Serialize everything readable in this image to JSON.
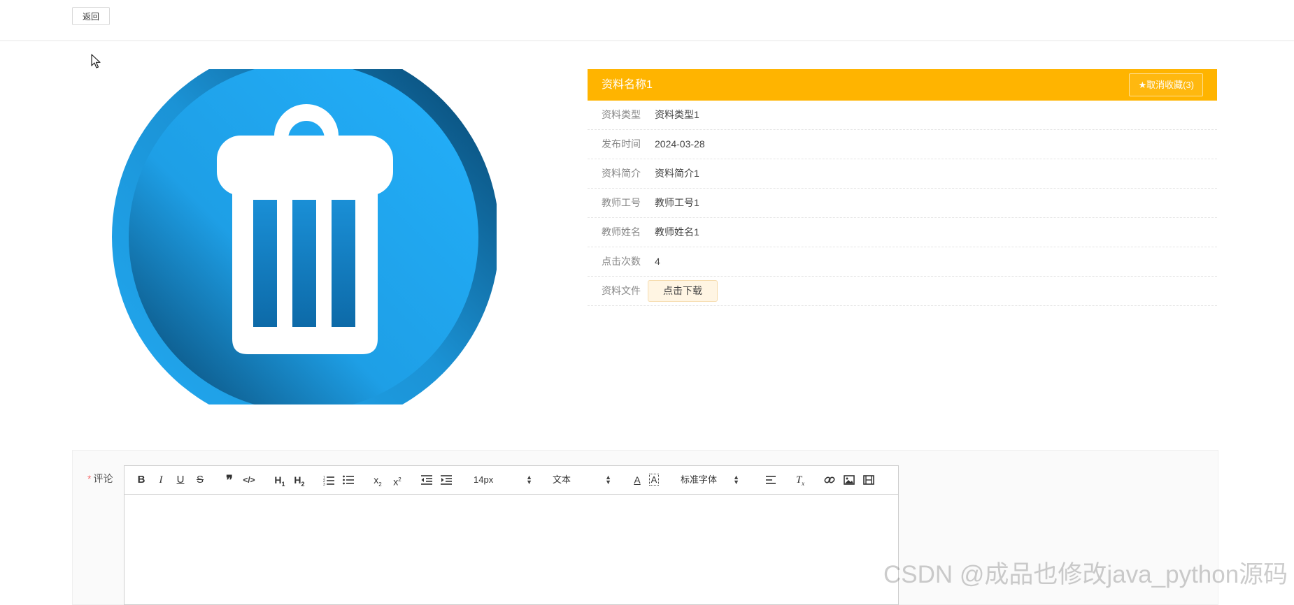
{
  "topbar": {
    "back_label": "返回"
  },
  "detail": {
    "title": "资料名称1",
    "favorite_label": "★取消收藏(3)",
    "fields": [
      {
        "label": "资料类型",
        "value": "资料类型1"
      },
      {
        "label": "发布时间",
        "value": "2024-03-28"
      },
      {
        "label": "资料简介",
        "value": "资料简介1"
      },
      {
        "label": "教师工号",
        "value": "教师工号1"
      },
      {
        "label": "教师姓名",
        "value": "教师姓名1"
      },
      {
        "label": "点击次数",
        "value": "4"
      }
    ],
    "file": {
      "label": "资料文件",
      "button": "点击下载"
    }
  },
  "comment": {
    "required_mark": "*",
    "label": "评论",
    "toolbar": {
      "font_size": "14px",
      "header_select": "文本",
      "font_family": "标准字体"
    }
  },
  "watermark": "CSDN @成品也修改java_python源码",
  "colors": {
    "accent": "#ffb400",
    "icon_blue": "#1aa8f0"
  }
}
